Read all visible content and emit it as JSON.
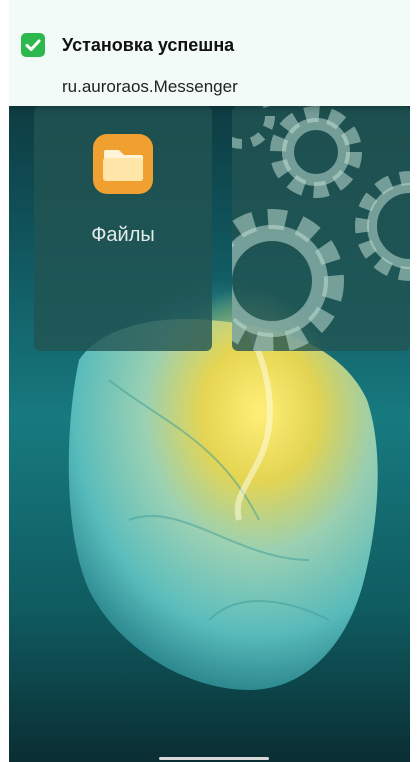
{
  "notification": {
    "icon": "check-icon",
    "icon_color": "#2db84d",
    "title": "Установка успешна",
    "subtitle": "ru.auroraos.Messenger"
  },
  "tiles": [
    {
      "label": "Файлы",
      "icon": "folder-icon",
      "icon_color": "#f0a030"
    },
    {
      "label": "",
      "icon": "gear-icon"
    }
  ]
}
